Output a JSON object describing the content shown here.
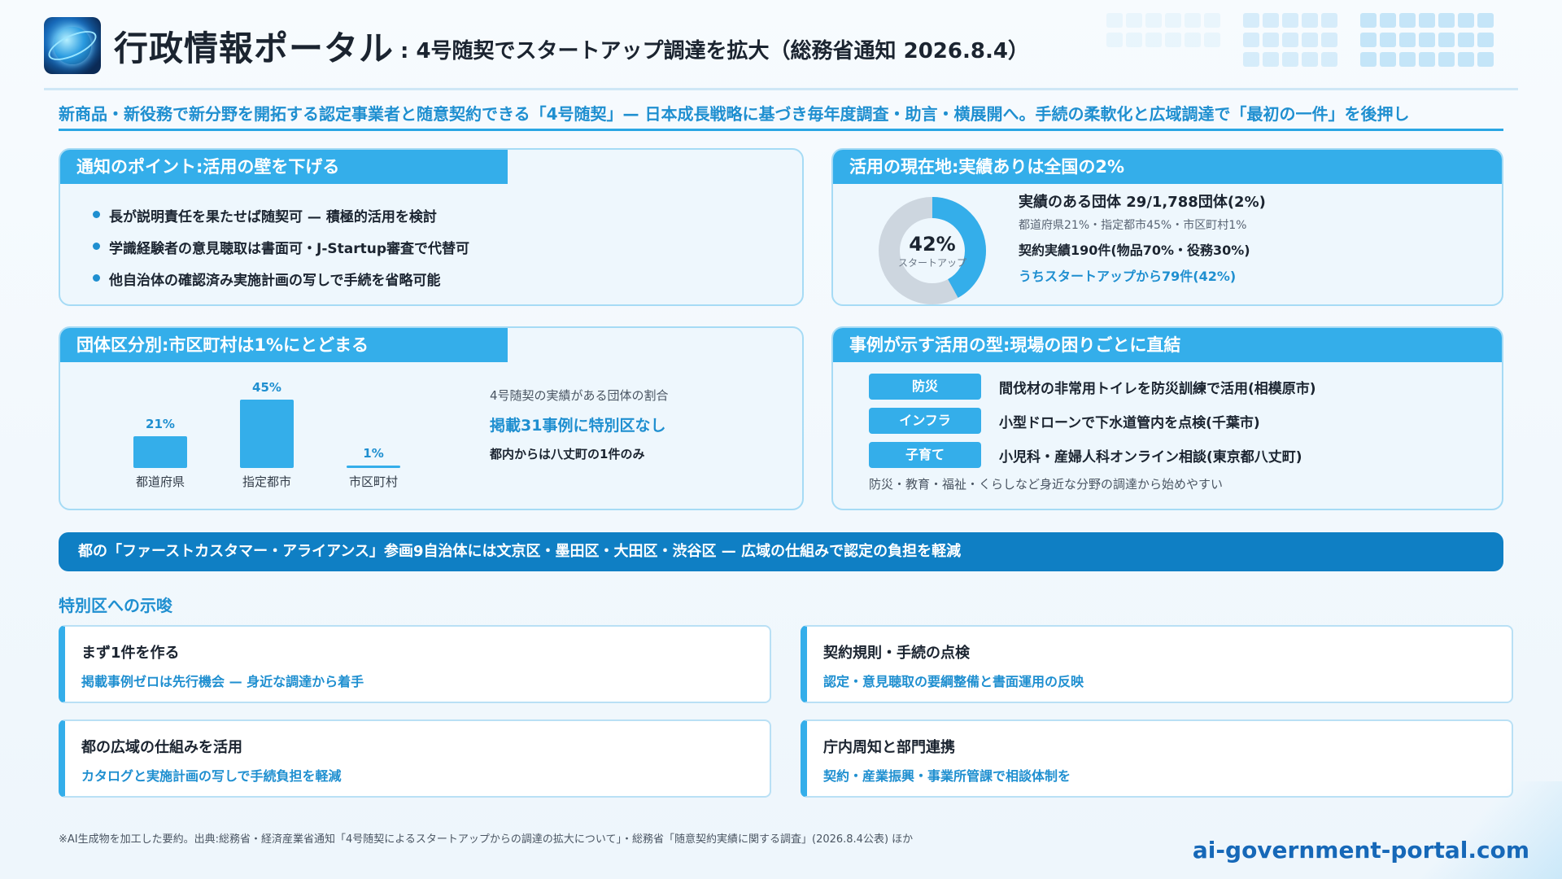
{
  "header": {
    "title": "行政情報ポータル",
    "subtitle": ": 4号随契でスタートアップ調達を拡大（総務省通知 2026.8.4）"
  },
  "lead": "新商品・新役務で新分野を開拓する認定事業者と随意契約できる「4号随契」— 日本成長戦略に基づき毎年度調査・助言・横展開へ。手続の柔軟化と広域調達で「最初の一件」を後押し",
  "points": {
    "heading": "通知のポイント:活用の壁を下げる",
    "items": [
      "長が説明責任を果たせば随契可 — 積極的活用を検討",
      "学識経験者の意見聴取は書面可・J-Startup審査で代替可",
      "他自治体の確認済み実施計画の写しで手続を省略可能"
    ]
  },
  "status": {
    "heading": "活用の現在地:実績ありは全国の2%",
    "donut": {
      "percent": 42,
      "label": "42%",
      "caption": "スタートアップ"
    },
    "main": "実績のある団体 29/1,788団体(2%)",
    "breakdown": "都道府県21%・指定都市45%・市区町村1%",
    "contracts": "契約実績190件(物品70%・役務30%)",
    "startups": "うちスタートアップから79件(42%)"
  },
  "by_type": {
    "heading": "団体区分別:市区町村は1%にとどまる",
    "note1": "4号随契の実績がある団体の割合",
    "note2": "掲載31事例に特別区なし",
    "note3": "都内からは八丈町の1件のみ"
  },
  "chart_data": {
    "type": "bar",
    "categories": [
      "都道府県",
      "指定都市",
      "市区町村"
    ],
    "values": [
      21,
      45,
      1
    ],
    "value_labels": [
      "21%",
      "45%",
      "1%"
    ],
    "title": "",
    "xlabel": "",
    "ylabel": ""
  },
  "cases": {
    "heading": "事例が示す活用の型:現場の困りごとに直結",
    "items": [
      {
        "tag": "防災",
        "text": "間伐材の非常用トイレを防災訓練で活用(相模原市)"
      },
      {
        "tag": "インフラ",
        "text": "小型ドローンで下水道管内を点検(千葉市)"
      },
      {
        "tag": "子育て",
        "text": "小児科・産婦人科オンライン相談(東京都八丈町)"
      }
    ],
    "note": "防災・教育・福祉・くらしなど身近な分野の調達から始めやすい"
  },
  "banner": "都の「ファーストカスタマー・アライアンス」参画9自治体には文京区・墨田区・大田区・渋谷区 — 広域の仕組みで認定の負担を軽減",
  "implications": {
    "heading": "特別区への示唆",
    "cards": [
      {
        "title": "まず1件を作る",
        "desc": "掲載事例ゼロは先行機会 — 身近な調達から着手"
      },
      {
        "title": "契約規則・手続の点検",
        "desc": "認定・意見聴取の要綱整備と書面運用の反映"
      },
      {
        "title": "都の広域の仕組みを活用",
        "desc": "カタログと実施計画の写しで手続負担を軽減"
      },
      {
        "title": "庁内周知と部門連携",
        "desc": "契約・産業振興・事業所管課で相談体制を"
      }
    ]
  },
  "footnote": "※AI生成物を加工した要約。出典:総務省・経済産業省通知「4号随契によるスタートアップからの調達の拡大について」・総務省「随意契約実績に関する調査」(2026.8.4公表) ほか",
  "site": "ai-government-portal.com",
  "colors": {
    "accent": "#34aeea",
    "accent_dark": "#0f7fc4",
    "text_accent": "#1f8fd0"
  }
}
